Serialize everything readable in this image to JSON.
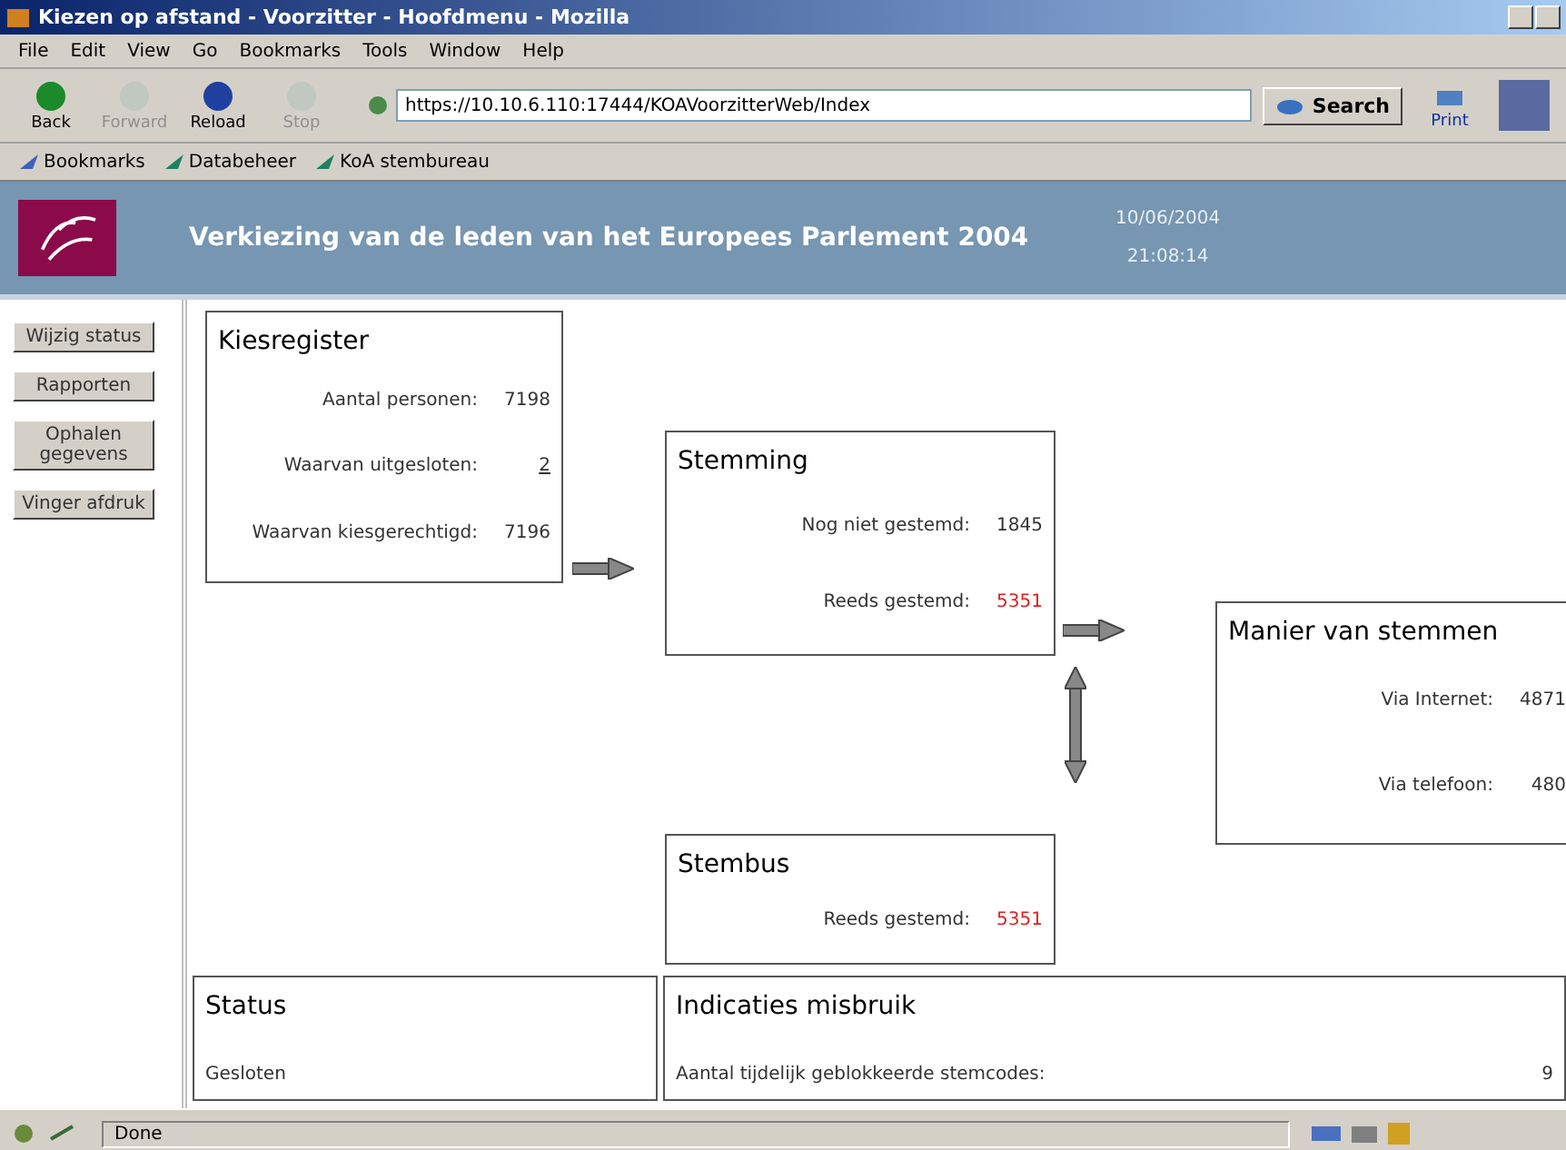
{
  "window": {
    "title": "Kiezen op afstand - Voorzitter - Hoofdmenu - Mozilla"
  },
  "menu": [
    "File",
    "Edit",
    "View",
    "Go",
    "Bookmarks",
    "Tools",
    "Window",
    "Help"
  ],
  "toolbar": [
    {
      "label": "Back",
      "disabled": false
    },
    {
      "label": "Forward",
      "disabled": true
    },
    {
      "label": "Reload",
      "disabled": false
    },
    {
      "label": "Stop",
      "disabled": true
    }
  ],
  "address": {
    "value": "https://10.10.6.110:17444/KOAVoorzitterWeb/Index"
  },
  "search_button": "Search",
  "print_button": "Print",
  "bookmarks": [
    "Bookmarks",
    "Databeheer",
    "KoA stembureau"
  ],
  "header": {
    "title": "Verkiezing van de leden van het Europees Parlement 2004",
    "date": "10/06/2004",
    "time": "21:08:14"
  },
  "sidebar": [
    "Wijzig status",
    "Rapporten",
    "Ophalen gegevens",
    "Vinger afdruk"
  ],
  "kiesregister": {
    "title": "Kiesregister",
    "rows": [
      {
        "label": "Aantal personen:",
        "value": "7198",
        "link": false,
        "alert": false
      },
      {
        "label": "Waarvan uitgesloten:",
        "value": "2",
        "link": true,
        "alert": false
      },
      {
        "label": "Waarvan kiesgerechtigd:",
        "value": "7196",
        "link": false,
        "alert": false
      }
    ]
  },
  "stemming": {
    "title": "Stemming",
    "rows": [
      {
        "label": "Nog niet gestemd:",
        "value": "1845",
        "link": false,
        "alert": false
      },
      {
        "label": "Reeds gestemd:",
        "value": "5351",
        "link": false,
        "alert": true
      }
    ]
  },
  "manier": {
    "title": "Manier van stemmen",
    "rows": [
      {
        "label": "Via Internet:",
        "value": "4871",
        "link": false,
        "alert": false
      },
      {
        "label": "Via telefoon:",
        "value": "480",
        "link": false,
        "alert": false
      }
    ]
  },
  "stembus": {
    "title": "Stembus",
    "rows": [
      {
        "label": "Reeds gestemd:",
        "value": "5351",
        "link": false,
        "alert": true
      }
    ]
  },
  "status": {
    "title": "Status",
    "value": "Gesloten"
  },
  "misbruik": {
    "title": "Indicaties misbruik",
    "label": "Aantal tijdelijk geblokkeerde stemcodes:",
    "value": "9"
  },
  "status_bar": "Done"
}
